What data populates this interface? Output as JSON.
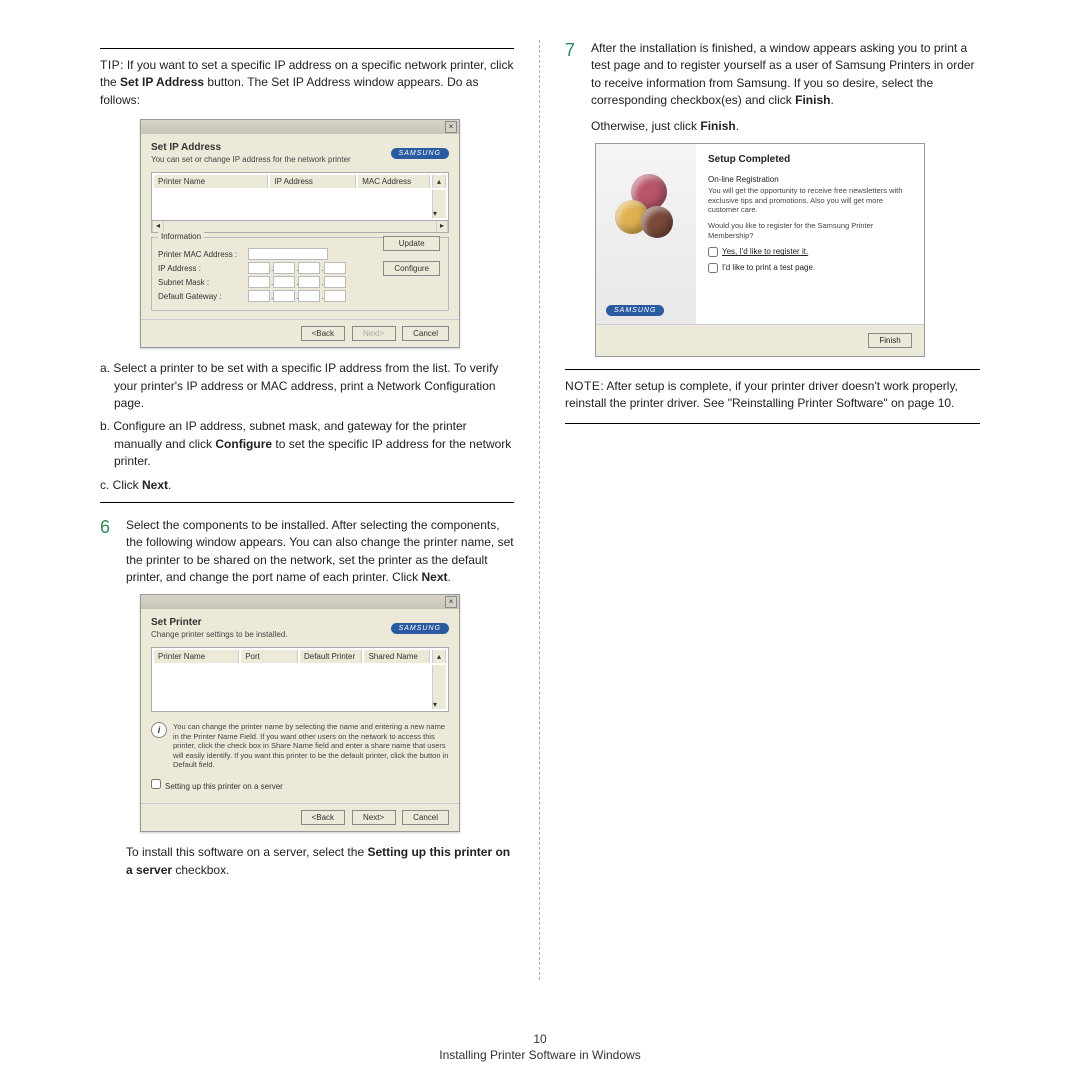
{
  "footer": {
    "page_num": "10",
    "section": "Installing Printer Software in Windows"
  },
  "left": {
    "tip_label": "TIP",
    "tip_text": ": If you want to set a specific IP address on a specific network printer, click the ",
    "tip_bold1": "Set IP Address",
    "tip_text2": " button. The Set IP Address window appears. Do as follows:",
    "dlg1": {
      "title": "Set IP Address",
      "subtitle": "You can set or change IP address for the network printer",
      "brand": "SAMSUNG",
      "col_printer": "Printer Name",
      "col_ip": "IP Address",
      "col_mac": "MAC Address",
      "grp_info": "Information",
      "lbl_mac": "Printer MAC Address :",
      "lbl_ip": "IP Address :",
      "lbl_mask": "Subnet Mask :",
      "lbl_gw": "Default Gateway :",
      "btn_update": "Update",
      "btn_configure": "Configure",
      "btn_back": "<Back",
      "btn_next": "Next>",
      "btn_cancel": "Cancel",
      "close_x": "×"
    },
    "list_a": "a. Select a printer to be set with a specific IP address from the list. To verify your printer's IP address or MAC address, print a Network Configuration page.",
    "list_b_1": "b. Configure an IP address, subnet mask, and gateway for the printer manually and click ",
    "list_b_bold": "Configure",
    "list_b_2": " to set the specific IP address for the network printer.",
    "list_c_1": "c. Click ",
    "list_c_bold": "Next",
    "list_c_2": ".",
    "step6_num": "6",
    "step6_text_1": "Select the components to be installed. After selecting the components, the following window appears. You can also change the printer name, set the printer to be shared on the network, set the printer as the default printer, and change the port name of each printer. Click ",
    "step6_bold": "Next",
    "step6_text_2": ".",
    "dlg2": {
      "title": "Set Printer",
      "subtitle": "Change printer settings to be installed.",
      "col1": "Printer Name",
      "col2": "Port",
      "col3": "Default Printer",
      "col4": "Shared Name",
      "info_text": "You can change the printer name by selecting the name and entering a new name in the Printer Name Field. If you want other users on the network to access this printer, click the check box in Share Name field and enter a share name that users will easily identify. If you want this printer to be the default printer, click the button in Default field.",
      "chk_server": "Setting up this printer on a server",
      "btn_back": "<Back",
      "btn_next": "Next>",
      "btn_cancel": "Cancel"
    },
    "after2_1": "To install this software on a server, select the ",
    "after2_bold": "Setting up this printer on a server",
    "after2_2": " checkbox."
  },
  "right": {
    "step7_num": "7",
    "step7_text_1": "After the installation is finished, a window appears asking you to print a test page and to register yourself as a user of Samsung Printers in order to receive information from Samsung. If you so desire, select the corresponding checkbox(es) and click ",
    "step7_bold": "Finish",
    "step7_text_2": ".",
    "otherwise_1": "Otherwise, just click ",
    "otherwise_bold": "Finish",
    "otherwise_2": ".",
    "dlg3": {
      "title": "Setup Completed",
      "reg_title": "On-line Registration",
      "reg_text": "You will get the opportunity to receive free newsletters with exclusive tips and promotions. Also you will get more customer care.",
      "question": "Would you like to register for the Samsung Printer Membership?",
      "chk1": "Yes, I'd like to register it.",
      "chk2": "I'd like to print a test page.",
      "brand": "SAMSUNG",
      "btn_finish": "Finish"
    },
    "note_label": "NOTE",
    "note_text": ": After setup is complete, if your printer driver doesn't work properly, reinstall the printer driver. See \"Reinstalling Printer Software\" on page 10."
  }
}
